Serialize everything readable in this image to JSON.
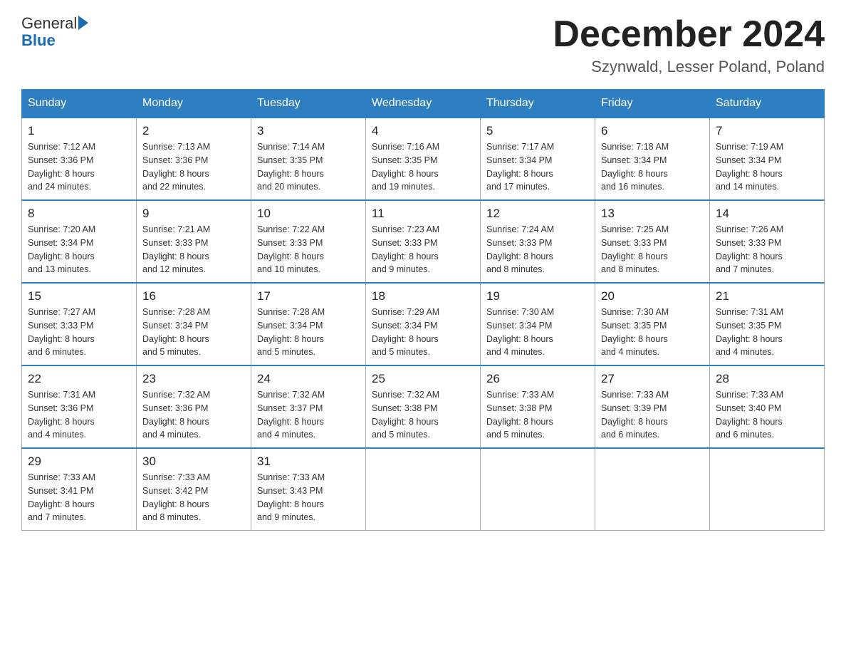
{
  "logo": {
    "general": "General",
    "blue": "Blue"
  },
  "title": {
    "month_year": "December 2024",
    "location": "Szynwald, Lesser Poland, Poland"
  },
  "headers": [
    "Sunday",
    "Monday",
    "Tuesday",
    "Wednesday",
    "Thursday",
    "Friday",
    "Saturday"
  ],
  "weeks": [
    [
      {
        "day": "1",
        "sunrise": "7:12 AM",
        "sunset": "3:36 PM",
        "daylight": "8 hours and 24 minutes."
      },
      {
        "day": "2",
        "sunrise": "7:13 AM",
        "sunset": "3:36 PM",
        "daylight": "8 hours and 22 minutes."
      },
      {
        "day": "3",
        "sunrise": "7:14 AM",
        "sunset": "3:35 PM",
        "daylight": "8 hours and 20 minutes."
      },
      {
        "day": "4",
        "sunrise": "7:16 AM",
        "sunset": "3:35 PM",
        "daylight": "8 hours and 19 minutes."
      },
      {
        "day": "5",
        "sunrise": "7:17 AM",
        "sunset": "3:34 PM",
        "daylight": "8 hours and 17 minutes."
      },
      {
        "day": "6",
        "sunrise": "7:18 AM",
        "sunset": "3:34 PM",
        "daylight": "8 hours and 16 minutes."
      },
      {
        "day": "7",
        "sunrise": "7:19 AM",
        "sunset": "3:34 PM",
        "daylight": "8 hours and 14 minutes."
      }
    ],
    [
      {
        "day": "8",
        "sunrise": "7:20 AM",
        "sunset": "3:34 PM",
        "daylight": "8 hours and 13 minutes."
      },
      {
        "day": "9",
        "sunrise": "7:21 AM",
        "sunset": "3:33 PM",
        "daylight": "8 hours and 12 minutes."
      },
      {
        "day": "10",
        "sunrise": "7:22 AM",
        "sunset": "3:33 PM",
        "daylight": "8 hours and 10 minutes."
      },
      {
        "day": "11",
        "sunrise": "7:23 AM",
        "sunset": "3:33 PM",
        "daylight": "8 hours and 9 minutes."
      },
      {
        "day": "12",
        "sunrise": "7:24 AM",
        "sunset": "3:33 PM",
        "daylight": "8 hours and 8 minutes."
      },
      {
        "day": "13",
        "sunrise": "7:25 AM",
        "sunset": "3:33 PM",
        "daylight": "8 hours and 8 minutes."
      },
      {
        "day": "14",
        "sunrise": "7:26 AM",
        "sunset": "3:33 PM",
        "daylight": "8 hours and 7 minutes."
      }
    ],
    [
      {
        "day": "15",
        "sunrise": "7:27 AM",
        "sunset": "3:33 PM",
        "daylight": "8 hours and 6 minutes."
      },
      {
        "day": "16",
        "sunrise": "7:28 AM",
        "sunset": "3:34 PM",
        "daylight": "8 hours and 5 minutes."
      },
      {
        "day": "17",
        "sunrise": "7:28 AM",
        "sunset": "3:34 PM",
        "daylight": "8 hours and 5 minutes."
      },
      {
        "day": "18",
        "sunrise": "7:29 AM",
        "sunset": "3:34 PM",
        "daylight": "8 hours and 5 minutes."
      },
      {
        "day": "19",
        "sunrise": "7:30 AM",
        "sunset": "3:34 PM",
        "daylight": "8 hours and 4 minutes."
      },
      {
        "day": "20",
        "sunrise": "7:30 AM",
        "sunset": "3:35 PM",
        "daylight": "8 hours and 4 minutes."
      },
      {
        "day": "21",
        "sunrise": "7:31 AM",
        "sunset": "3:35 PM",
        "daylight": "8 hours and 4 minutes."
      }
    ],
    [
      {
        "day": "22",
        "sunrise": "7:31 AM",
        "sunset": "3:36 PM",
        "daylight": "8 hours and 4 minutes."
      },
      {
        "day": "23",
        "sunrise": "7:32 AM",
        "sunset": "3:36 PM",
        "daylight": "8 hours and 4 minutes."
      },
      {
        "day": "24",
        "sunrise": "7:32 AM",
        "sunset": "3:37 PM",
        "daylight": "8 hours and 4 minutes."
      },
      {
        "day": "25",
        "sunrise": "7:32 AM",
        "sunset": "3:38 PM",
        "daylight": "8 hours and 5 minutes."
      },
      {
        "day": "26",
        "sunrise": "7:33 AM",
        "sunset": "3:38 PM",
        "daylight": "8 hours and 5 minutes."
      },
      {
        "day": "27",
        "sunrise": "7:33 AM",
        "sunset": "3:39 PM",
        "daylight": "8 hours and 6 minutes."
      },
      {
        "day": "28",
        "sunrise": "7:33 AM",
        "sunset": "3:40 PM",
        "daylight": "8 hours and 6 minutes."
      }
    ],
    [
      {
        "day": "29",
        "sunrise": "7:33 AM",
        "sunset": "3:41 PM",
        "daylight": "8 hours and 7 minutes."
      },
      {
        "day": "30",
        "sunrise": "7:33 AM",
        "sunset": "3:42 PM",
        "daylight": "8 hours and 8 minutes."
      },
      {
        "day": "31",
        "sunrise": "7:33 AM",
        "sunset": "3:43 PM",
        "daylight": "8 hours and 9 minutes."
      },
      null,
      null,
      null,
      null
    ]
  ],
  "labels": {
    "sunrise": "Sunrise:",
    "sunset": "Sunset:",
    "daylight": "Daylight:"
  }
}
